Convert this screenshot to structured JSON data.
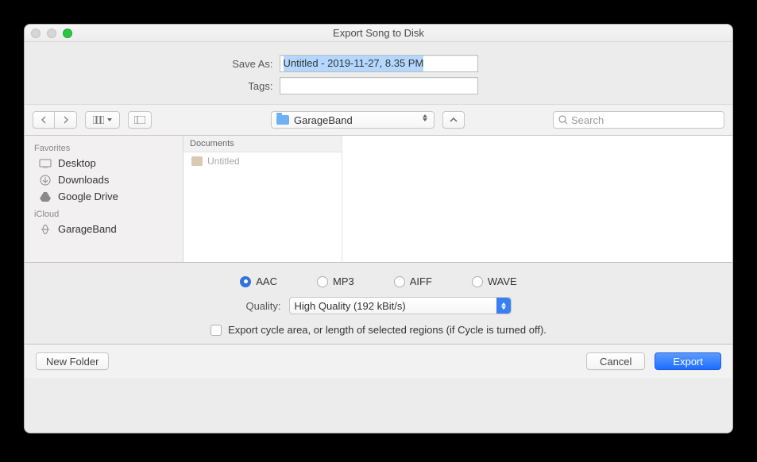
{
  "window": {
    "title": "Export Song to Disk"
  },
  "saveas": {
    "label": "Save As:",
    "value": "Untitled - 2019-11-27, 8.35 PM"
  },
  "tags": {
    "label": "Tags:",
    "value": ""
  },
  "path": {
    "folder": "GarageBand"
  },
  "search": {
    "placeholder": "Search"
  },
  "sidebar": {
    "sections": [
      {
        "header": "Favorites",
        "items": [
          {
            "icon": "desktop-icon",
            "label": "Desktop"
          },
          {
            "icon": "downloads-icon",
            "label": "Downloads"
          },
          {
            "icon": "google-drive-icon",
            "label": "Google Drive"
          }
        ]
      },
      {
        "header": "iCloud",
        "items": [
          {
            "icon": "garageband-icon",
            "label": "GarageBand"
          }
        ]
      }
    ]
  },
  "column": {
    "header": "Documents",
    "items": [
      {
        "icon": "project-icon",
        "label": "Untitled"
      }
    ]
  },
  "format": {
    "options": [
      "AAC",
      "MP3",
      "AIFF",
      "WAVE"
    ],
    "selected": "AAC"
  },
  "quality": {
    "label": "Quality:",
    "value": "High Quality (192 kBit/s)"
  },
  "cycle": {
    "checked": false,
    "label": "Export cycle area, or length of selected regions (if Cycle is turned off)."
  },
  "footer": {
    "newfolder": "New Folder",
    "cancel": "Cancel",
    "export": "Export"
  }
}
